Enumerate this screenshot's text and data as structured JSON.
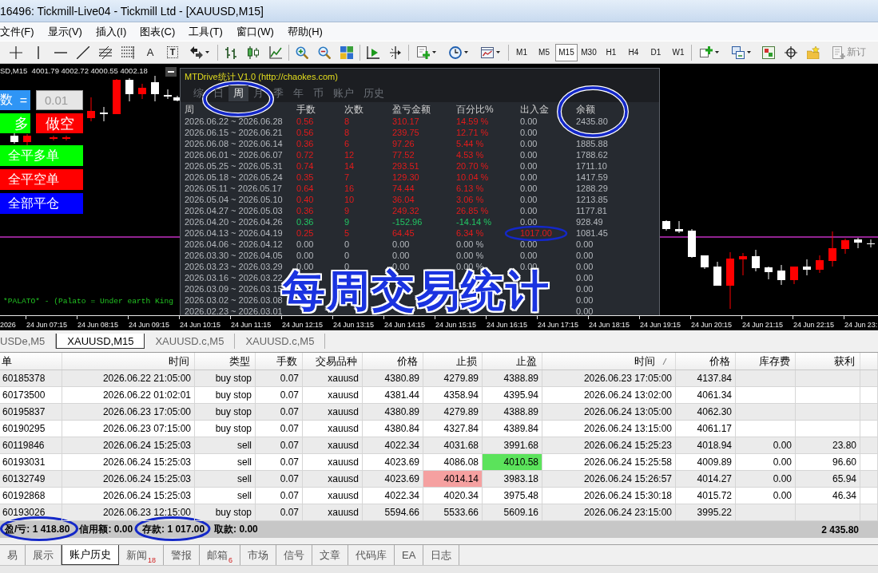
{
  "window": {
    "title": "16496: Tickmill-Live04 - Tickmill Ltd - [XAUUSD,M15]"
  },
  "menu": [
    "文件(F)",
    "显示(V)",
    "插入(I)",
    "图表(C)",
    "工具(T)",
    "窗口(W)",
    "帮助(H)"
  ],
  "toolbar": {
    "text_tool": "A",
    "label_tool": "T",
    "timeframes": [
      {
        "label": "M1",
        "selected": false
      },
      {
        "label": "M5",
        "selected": false
      },
      {
        "label": "M15",
        "selected": true
      },
      {
        "label": "M30",
        "selected": false
      },
      {
        "label": "H1",
        "selected": false
      },
      {
        "label": "H4",
        "selected": false
      },
      {
        "label": "D1",
        "selected": false
      },
      {
        "label": "W1",
        "selected": false
      }
    ],
    "new_order": "新订"
  },
  "chart": {
    "header": "SD,M15  4001.79 4002.72 4000.55 4002.18",
    "lots": {
      "label": "数",
      "sign": "=",
      "value": "0.01"
    },
    "buttons": [
      {
        "label": "多",
        "color": "#00ff00",
        "kind": "half"
      },
      {
        "label": "做空",
        "color": "#ff0000",
        "kind": "half"
      },
      {
        "label": "全平多单",
        "color": "#00ff00",
        "kind": "wide"
      },
      {
        "label": "全平空单",
        "color": "#ff0000",
        "kind": "wide"
      },
      {
        "label": "全部平仓",
        "color": "#0000ff",
        "kind": "wide"
      }
    ],
    "ticker": "*PALATO* - (Palato = Under earth King",
    "time_axis": [
      "2026",
      "24 Jun 07:15",
      "24 Jun 08:15",
      "24 Jun 09:15",
      "24 Jun 10:15",
      "24 Jun 11:15",
      "24 Jun 12:15",
      "24 Jun 13:15",
      "24 Jun 14:15",
      "24 Jun 15:15",
      "24 Jun 16:15",
      "24 Jun 17:15",
      "24 Jun 18:15",
      "24 Jun 19:15",
      "24 Jun 20:15",
      "24 Jun 21:15",
      "24 Jun 22:15",
      "24 Jun 23:"
    ]
  },
  "stats_panel": {
    "title": "MTDrive统计 V1.0 (http://chaokes.com)",
    "tabs": [
      {
        "label": "综",
        "selected": false
      },
      {
        "label": "日",
        "selected": false
      },
      {
        "label": "周",
        "selected": true
      },
      {
        "label": "月",
        "selected": false
      },
      {
        "label": "季",
        "selected": false
      },
      {
        "label": "年",
        "selected": false
      },
      {
        "label": "币",
        "selected": false
      },
      {
        "label": "账户",
        "selected": false
      },
      {
        "label": "历史",
        "selected": false
      }
    ],
    "columns": [
      "周",
      "手数",
      "次数",
      "盈亏金额",
      "百分比%",
      "出入金",
      "余额"
    ],
    "rows": [
      {
        "period": "2026.06.22 ~ 2026.06.28",
        "lots": "0.56",
        "count": "8",
        "pnl": "310.17",
        "pct": "14.59 %",
        "flow": "0.00",
        "balance": "2435.80",
        "color": "#e21b1b",
        "deposit": false
      },
      {
        "period": "2026.06.15 ~ 2026.06.21",
        "lots": "0.56",
        "count": "8",
        "pnl": "239.75",
        "pct": "12.71 %",
        "flow": "0.00",
        "color": "#e21b1b",
        "deposit": false
      },
      {
        "period": "2026.06.08 ~ 2026.06.14",
        "lots": "0.36",
        "count": "6",
        "pnl": "97.26",
        "pct": "5.44 %",
        "flow": "0.00",
        "balance": "1885.88",
        "color": "#e21b1b",
        "deposit": false
      },
      {
        "period": "2026.06.01 ~ 2026.06.07",
        "lots": "0.72",
        "count": "12",
        "pnl": "77.52",
        "pct": "4.53 %",
        "flow": "0.00",
        "balance": "1788.62",
        "color": "#e21b1b",
        "deposit": false
      },
      {
        "period": "2026.05.25 ~ 2026.05.31",
        "lots": "0.74",
        "count": "14",
        "pnl": "293.51",
        "pct": "20.70 %",
        "flow": "0.00",
        "balance": "1711.10",
        "color": "#e21b1b",
        "deposit": false
      },
      {
        "period": "2026.05.18 ~ 2026.05.24",
        "lots": "0.35",
        "count": "7",
        "pnl": "129.30",
        "pct": "10.04 %",
        "flow": "0.00",
        "balance": "1417.59",
        "color": "#e21b1b",
        "deposit": false
      },
      {
        "period": "2026.05.11 ~ 2026.05.17",
        "lots": "0.64",
        "count": "16",
        "pnl": "74.44",
        "pct": "6.13 %",
        "flow": "0.00",
        "balance": "1288.29",
        "color": "#e21b1b",
        "deposit": false
      },
      {
        "period": "2026.05.04 ~ 2026.05.10",
        "lots": "0.40",
        "count": "10",
        "pnl": "36.04",
        "pct": "3.06 %",
        "flow": "0.00",
        "balance": "1213.85",
        "color": "#e21b1b",
        "deposit": false
      },
      {
        "period": "2026.04.27 ~ 2026.05.03",
        "lots": "0.36",
        "count": "9",
        "pnl": "249.32",
        "pct": "26.85 %",
        "flow": "0.00",
        "balance": "1177.81",
        "color": "#e21b1b",
        "deposit": false
      },
      {
        "period": "2026.04.20 ~ 2026.04.26",
        "lots": "0.36",
        "count": "9",
        "pnl": "-152.96",
        "pct": "-14.14 %",
        "flow": "0.00",
        "balance": "928.49",
        "color": "#22c563",
        "deposit": false
      },
      {
        "period": "2026.04.13 ~ 2026.04.19",
        "lots": "0.25",
        "count": "5",
        "pnl": "64.45",
        "pct": "6.34 %",
        "flow": "1017.00",
        "balance": "1081.45",
        "color": "#e21b1b",
        "deposit": true
      },
      {
        "period": "2026.04.06 ~ 2026.04.12",
        "lots": "0.00",
        "count": "0",
        "pnl": "0.00",
        "pct": "0.00 %",
        "flow": "0.00",
        "balance": "0.00",
        "deposit": false
      },
      {
        "period": "2026.03.30 ~ 2026.04.05",
        "lots": "0.00",
        "count": "0",
        "pnl": "0.00",
        "pct": "0.00 %",
        "flow": "0.00",
        "balance": "0.00",
        "deposit": false
      },
      {
        "period": "2026.03.23 ~ 2026.03.29",
        "lots": "0.00",
        "count": "0",
        "pnl": "0.00",
        "pct": "0.00 %",
        "flow": "0.00",
        "balance": "0.00",
        "deposit": false
      },
      {
        "period": "2026.03.16 ~ 2026.03.22",
        "balance": "0.00"
      },
      {
        "period": "2026.03.09 ~ 2026.03.15",
        "balance": "0.00"
      },
      {
        "period": "2026.03.02 ~ 2026.03.08",
        "balance": "0.00"
      },
      {
        "period": "2026.02.23 ~ 2026.03.01",
        "balance": "0.00"
      }
    ]
  },
  "caption": "每周交易统计",
  "chart_tabs": [
    {
      "label": "USDe,M5",
      "selected": false
    },
    {
      "label": "XAUUSD,M15",
      "selected": true
    },
    {
      "label": "XAUUSD.c,M5",
      "selected": false
    },
    {
      "label": "XAUUSD.c,M5",
      "selected": false
    }
  ],
  "terminal": {
    "columns": [
      {
        "label": "单",
        "sorted": false
      },
      {
        "label": "时间",
        "sorted": false
      },
      {
        "label": "类型",
        "sorted": false
      },
      {
        "label": "手数",
        "sorted": false
      },
      {
        "label": "交易品种",
        "sorted": false
      },
      {
        "label": "价格",
        "sorted": false
      },
      {
        "label": "止损",
        "sorted": false
      },
      {
        "label": "止盈",
        "sorted": false
      },
      {
        "label": "时间",
        "sorted": true
      },
      {
        "label": "价格",
        "sorted": false
      },
      {
        "label": "库存费",
        "sorted": false
      },
      {
        "label": "获利",
        "sorted": false
      }
    ],
    "rows": [
      {
        "ticket": "60185378",
        "open_time": "2026.06.22 21:05:00",
        "type": "buy stop",
        "lots": "0.07",
        "symbol": "xauusd",
        "price": "4380.89",
        "sl": "4279.89",
        "tp": "4388.89",
        "close_time": "2026.06.23 17:05:00",
        "close_price": "4137.84",
        "sl_marked": false,
        "tp_marked": false
      },
      {
        "ticket": "60173500",
        "open_time": "2026.06.22 01:02:01",
        "type": "buy stop",
        "lots": "0.07",
        "symbol": "xauusd",
        "price": "4381.44",
        "sl": "4358.94",
        "tp": "4395.94",
        "close_time": "2026.06.24 13:02:00",
        "close_price": "4061.34",
        "sl_marked": false,
        "tp_marked": false
      },
      {
        "ticket": "60195837",
        "open_time": "2026.06.23 17:05:00",
        "type": "buy stop",
        "lots": "0.07",
        "symbol": "xauusd",
        "price": "4380.89",
        "sl": "4279.89",
        "tp": "4388.89",
        "close_time": "2026.06.24 13:05:00",
        "close_price": "4062.30",
        "sl_marked": false,
        "tp_marked": false
      },
      {
        "ticket": "60190295",
        "open_time": "2026.06.23 07:15:00",
        "type": "buy stop",
        "lots": "0.07",
        "symbol": "xauusd",
        "price": "4380.84",
        "sl": "4327.84",
        "tp": "4389.84",
        "close_time": "2026.06.24 13:15:00",
        "close_price": "4061.17",
        "sl_marked": false,
        "tp_marked": false
      },
      {
        "ticket": "60119846",
        "open_time": "2026.06.24 15:25:03",
        "type": "sell",
        "lots": "0.07",
        "symbol": "xauusd",
        "price": "4022.34",
        "sl": "4031.68",
        "tp": "3991.68",
        "close_time": "2026.06.24 15:25:23",
        "close_price": "4018.94",
        "swap": "0.00",
        "profit": "23.80",
        "sl_marked": false,
        "tp_marked": false
      },
      {
        "ticket": "60193031",
        "open_time": "2026.06.24 15:25:03",
        "type": "sell",
        "lots": "0.07",
        "symbol": "xauusd",
        "price": "4023.69",
        "sl": "4086.08",
        "tp": "4010.58",
        "close_time": "2026.06.24 15:25:58",
        "close_price": "4009.89",
        "swap": "0.00",
        "profit": "96.60",
        "sl_marked": false,
        "tp_marked": true
      },
      {
        "ticket": "60132749",
        "open_time": "2026.06.24 15:25:03",
        "type": "sell",
        "lots": "0.07",
        "symbol": "xauusd",
        "price": "4023.69",
        "sl": "4014.14",
        "tp": "3983.18",
        "close_time": "2026.06.24 15:26:57",
        "close_price": "4014.27",
        "swap": "0.00",
        "profit": "65.94",
        "sl_marked": true,
        "tp_marked": false
      },
      {
        "ticket": "60192868",
        "open_time": "2026.06.24 15:25:03",
        "type": "sell",
        "lots": "0.07",
        "symbol": "xauusd",
        "price": "4022.34",
        "sl": "4020.34",
        "tp": "3975.48",
        "close_time": "2026.06.24 15:30:18",
        "close_price": "4015.72",
        "swap": "0.00",
        "profit": "46.34",
        "sl_marked": false,
        "tp_marked": false
      },
      {
        "ticket": "60193026",
        "open_time": "2026.06.23 12:15:00",
        "type": "buy stop",
        "lots": "0.07",
        "symbol": "xauusd",
        "price": "5594.66",
        "sl": "5533.66",
        "tp": "5609.16",
        "close_time": "2026.06.24 23:15:00",
        "close_price": "3995.22",
        "sl_marked": false,
        "tp_marked": false
      }
    ],
    "summary": {
      "profit_loss": "盈/亏: 1 418.80",
      "credit": "信用额: 0.00",
      "deposit": "存款: 1 017.00",
      "withdrawal": "取款: 0.00",
      "total": "2 435.80"
    },
    "tabs": [
      {
        "label": "易",
        "selected": false
      },
      {
        "label": "展示",
        "selected": false
      },
      {
        "label": "账户历史",
        "selected": true
      },
      {
        "label": "新闻",
        "badge": "18",
        "selected": false
      },
      {
        "label": "警报",
        "selected": false
      },
      {
        "label": "邮箱",
        "badge": "6",
        "selected": false
      },
      {
        "label": "市场",
        "selected": false
      },
      {
        "label": "信号",
        "selected": false
      },
      {
        "label": "文章",
        "selected": false
      },
      {
        "label": "代码库",
        "selected": false
      },
      {
        "label": "EA",
        "selected": false
      },
      {
        "label": "日志",
        "selected": false
      }
    ]
  }
}
